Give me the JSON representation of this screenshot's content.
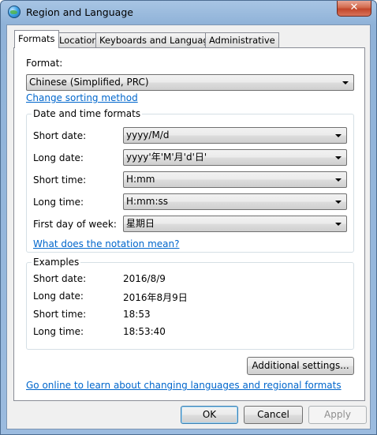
{
  "window": {
    "title": "Region and Language",
    "close_glyph": "✕"
  },
  "tabs": [
    {
      "label": "Formats"
    },
    {
      "label": "Location"
    },
    {
      "label": "Keyboards and Languages"
    },
    {
      "label": "Administrative"
    }
  ],
  "formats": {
    "format_label": "Format:",
    "format_value": "Chinese (Simplified, PRC)",
    "change_sorting_link": "Change sorting method",
    "datetime_group_title": "Date and time formats",
    "fields": [
      {
        "label": "Short date:",
        "value": "yyyy/M/d"
      },
      {
        "label": "Long date:",
        "value": "yyyy'年'M'月'd'日'"
      },
      {
        "label": "Short time:",
        "value": "H:mm"
      },
      {
        "label": "Long time:",
        "value": "H:mm:ss"
      },
      {
        "label": "First day of week:",
        "value": "星期日"
      }
    ],
    "notation_link": "What does the notation mean?",
    "examples_group_title": "Examples",
    "examples": [
      {
        "label": "Short date:",
        "value": "2016/8/9"
      },
      {
        "label": "Long date:",
        "value": "2016年8月9日"
      },
      {
        "label": "Short time:",
        "value": "18:53"
      },
      {
        "label": "Long time:",
        "value": "18:53:40"
      }
    ],
    "additional_settings_button": "Additional settings...",
    "online_link": "Go online to learn about changing languages and regional formats"
  },
  "footer": {
    "ok": "OK",
    "cancel": "Cancel",
    "apply": "Apply"
  }
}
